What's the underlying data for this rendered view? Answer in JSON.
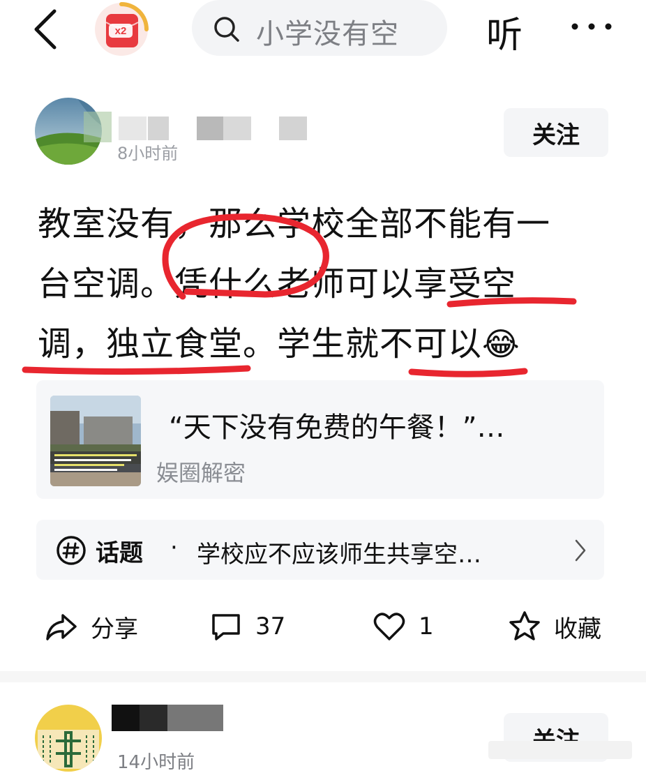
{
  "topbar": {
    "badge_text": "x2",
    "search_text": "小学没有空",
    "listen_label": "听"
  },
  "post": {
    "time": "8小时前",
    "follow_label": "关注",
    "lines": [
      "教室没有，那么学校全部不能有一",
      "台空调。凭什么老师可以享受空",
      "调，独立食堂。学生就不可以"
    ],
    "emoji": "😂",
    "link_card": {
      "title": "“天下没有免费的午餐！”…",
      "source": "娱圈解密"
    },
    "topic": {
      "label": "话题",
      "separator": "·",
      "text": "学校应不应该师生共享空…"
    },
    "actions": {
      "share_label": "分享",
      "comments": "37",
      "likes": "1",
      "favorite_label": "收藏"
    }
  },
  "next_post": {
    "time": "14小时前",
    "follow_label": "关注"
  },
  "colors": {
    "annotation_red": "#e8262f",
    "badge_red": "#e83a3f",
    "badge_gold": "#f0b43c"
  }
}
